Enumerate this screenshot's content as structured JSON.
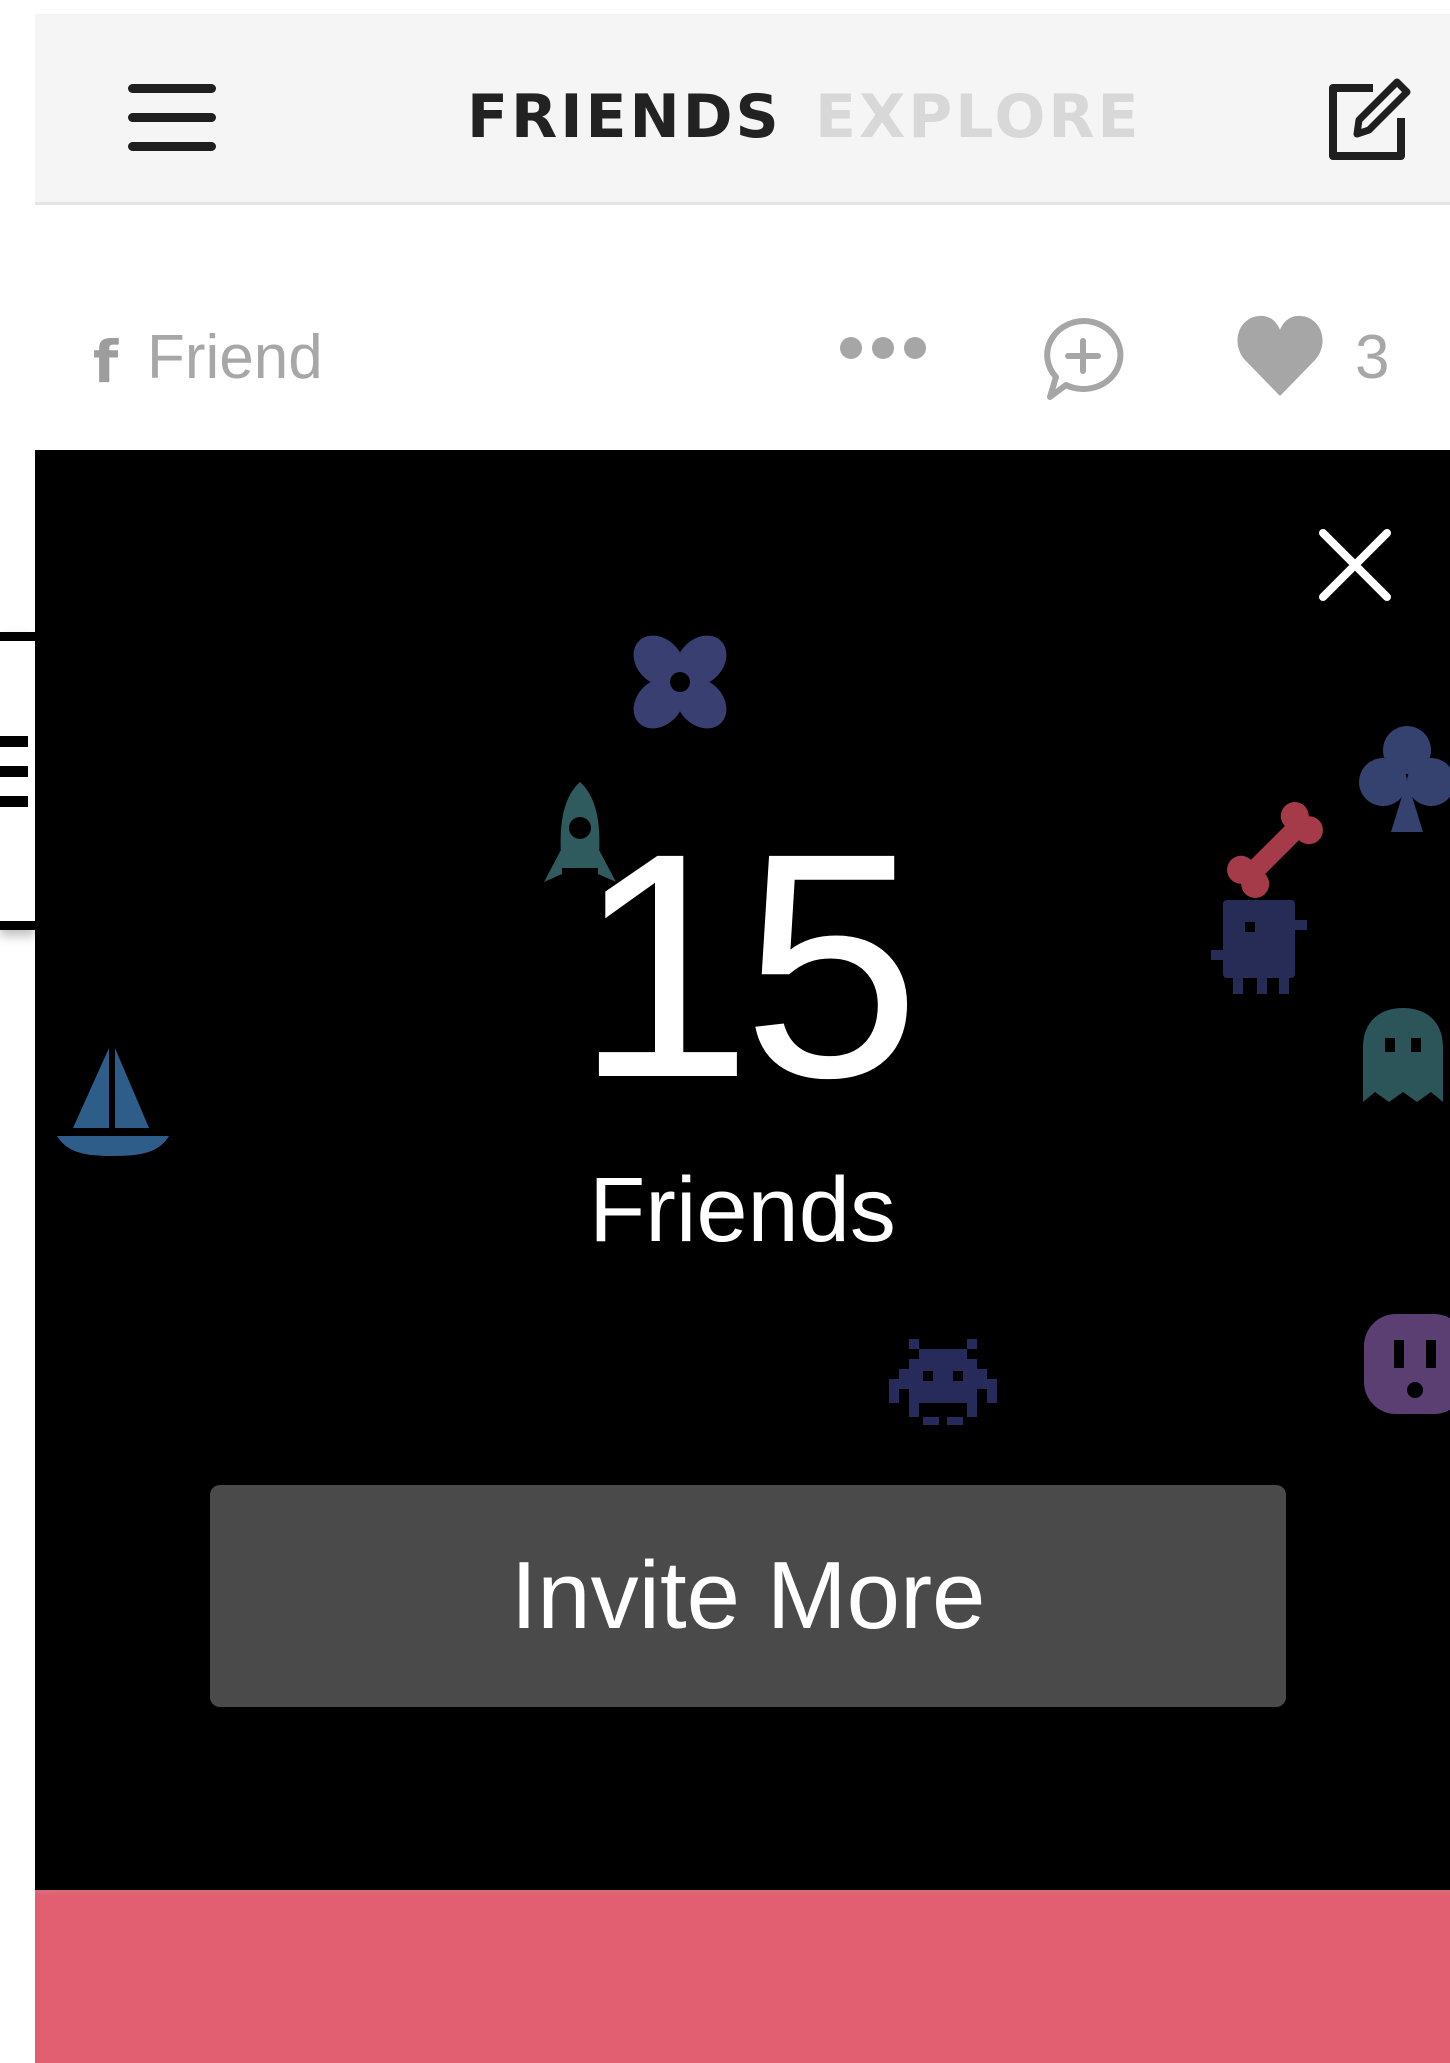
{
  "header": {
    "tabs": [
      {
        "label": "FRIENDS",
        "active": true
      },
      {
        "label": "EXPLORE",
        "active": false
      }
    ],
    "menu_icon": "hamburger-icon",
    "compose_icon": "compose-icon"
  },
  "post": {
    "source_icon": "facebook-icon",
    "source_glyph": "f",
    "source_label": "Friend",
    "more_icon": "more-dots-icon",
    "comment_icon": "add-comment-icon",
    "like_icon": "heart-icon",
    "like_count": "3"
  },
  "friends_card": {
    "count": "15",
    "label": "Friends",
    "invite_label": "Invite More",
    "close_icon": "close-icon",
    "decorations": [
      "flower-icon",
      "rocket-icon",
      "bone-icon",
      "club-icon",
      "monster-icon",
      "ghost-icon",
      "sailboat-icon",
      "space-invader-icon",
      "outlet-icon"
    ]
  },
  "colors": {
    "card_bg": "#000000",
    "button_bg": "#4a4a4a",
    "accent_pink": "#e15f70",
    "tab_active": "#222222",
    "tab_inactive": "#d8d8d8"
  }
}
